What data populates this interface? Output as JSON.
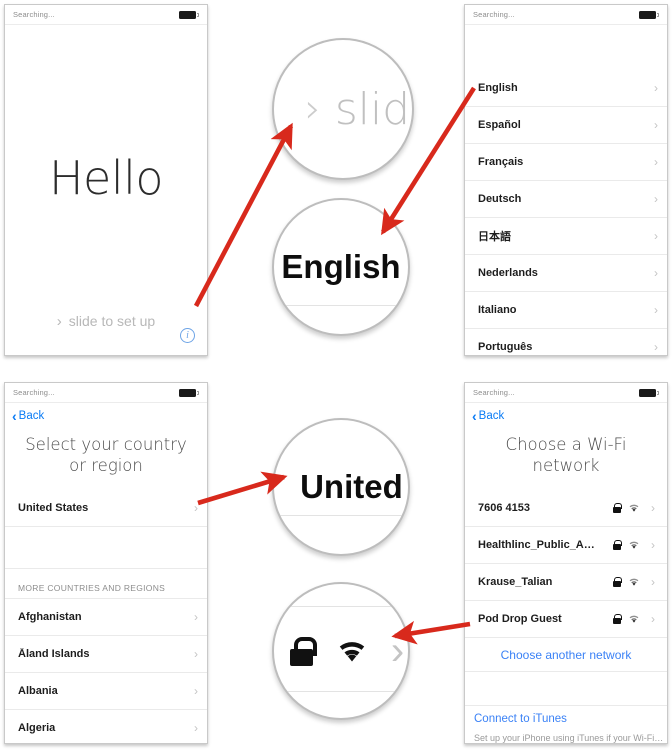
{
  "status": {
    "text": "Searching...",
    "battery_icon": "battery-full-icon"
  },
  "panel_hello": {
    "name": "iphone-hello-screen",
    "title": "Hello",
    "slide_chevron": "chevron-right-icon",
    "slide_label": "slide to set up",
    "info_label": "i"
  },
  "panel_language": {
    "name": "iphone-language-screen",
    "items": [
      {
        "label": "English",
        "chevron": "›"
      },
      {
        "label": "Español",
        "chevron": "›"
      },
      {
        "label": "Français",
        "chevron": "›"
      },
      {
        "label": "Deutsch",
        "chevron": "›"
      },
      {
        "label": "日本語",
        "chevron": "›"
      },
      {
        "label": "Nederlands",
        "chevron": "›"
      },
      {
        "label": "Italiano",
        "chevron": "›"
      },
      {
        "label": "Português",
        "chevron": "›"
      }
    ]
  },
  "panel_country": {
    "name": "iphone-country-screen",
    "back_label": "Back",
    "heading": "Select your country or region",
    "selected": {
      "label": "United States",
      "chevron": "›"
    },
    "section_header": "MORE COUNTRIES AND REGIONS",
    "items": [
      {
        "label": "Afghanistan",
        "chevron": "›"
      },
      {
        "label": "Åland Islands",
        "chevron": "›"
      },
      {
        "label": "Albania",
        "chevron": "›"
      },
      {
        "label": "Algeria",
        "chevron": "›"
      }
    ]
  },
  "panel_wifi": {
    "name": "iphone-wifi-screen",
    "back_label": "Back",
    "heading": "Choose a Wi-Fi network",
    "networks": [
      {
        "label": "7606 4153",
        "lock": "lock-icon",
        "signal": "wifi-icon",
        "chevron": "›"
      },
      {
        "label": "Healthlinc_Public_A…",
        "lock": "lock-icon",
        "signal": "wifi-icon",
        "chevron": "›"
      },
      {
        "label": "Krause_Talian",
        "lock": "lock-icon",
        "signal": "wifi-icon",
        "chevron": "›"
      },
      {
        "label": "Pod Drop Guest",
        "lock": "lock-icon",
        "signal": "wifi-icon",
        "chevron": "›"
      }
    ],
    "another_network_label": "Choose another network",
    "itunes_link": "Connect to iTunes",
    "itunes_note": "Set up your iPhone using iTunes if your Wi-Fi…"
  },
  "magnifiers": [
    {
      "name": "magnifier-slide",
      "chevron": "›",
      "text": "slide"
    },
    {
      "name": "magnifier-english",
      "text": "English"
    },
    {
      "name": "magnifier-united-states",
      "text": "United S"
    },
    {
      "name": "magnifier-wifi-row",
      "lock": "lock-icon",
      "signal": "wifi-icon",
      "chevron": "›"
    }
  ],
  "annotations": {
    "arrow_color": "#d8291c",
    "arrows": [
      {
        "name": "arrow-slide-to-magnifier"
      },
      {
        "name": "arrow-english-to-magnifier"
      },
      {
        "name": "arrow-united-states-to-magnifier"
      },
      {
        "name": "arrow-wifi-row-to-magnifier"
      }
    ]
  }
}
